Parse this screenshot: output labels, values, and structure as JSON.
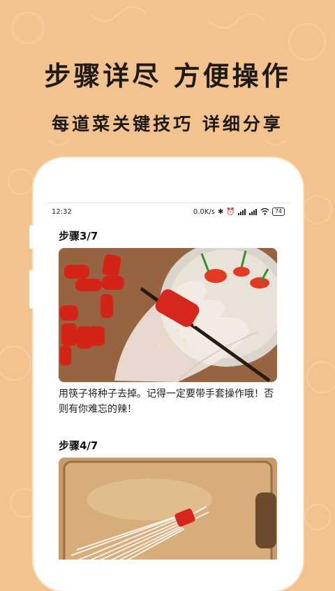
{
  "banner": {
    "headline": "步骤详尽 方便操作",
    "subline": "每道菜关键技巧 详细分享"
  },
  "status_bar": {
    "time": "12:32",
    "network_speed": "0.0K/s",
    "battery": "74",
    "icons": [
      "bluetooth-icon",
      "alarm-icon",
      "signal-icon",
      "signal-hd-icon",
      "wifi-icon",
      "battery-icon"
    ]
  },
  "steps": [
    {
      "title": "步骤3/7",
      "image_icon": "chili-seeding-photo",
      "caption": "用筷子将种子去掉。记得一定要带手套操作哦！否则有你难忘的辣！"
    },
    {
      "title": "步骤4/7",
      "image_icon": "enoki-tied-photo"
    }
  ],
  "colors": {
    "background": "#F2C38E",
    "text": "#1f1a17",
    "chili_red": "#D7261E"
  }
}
